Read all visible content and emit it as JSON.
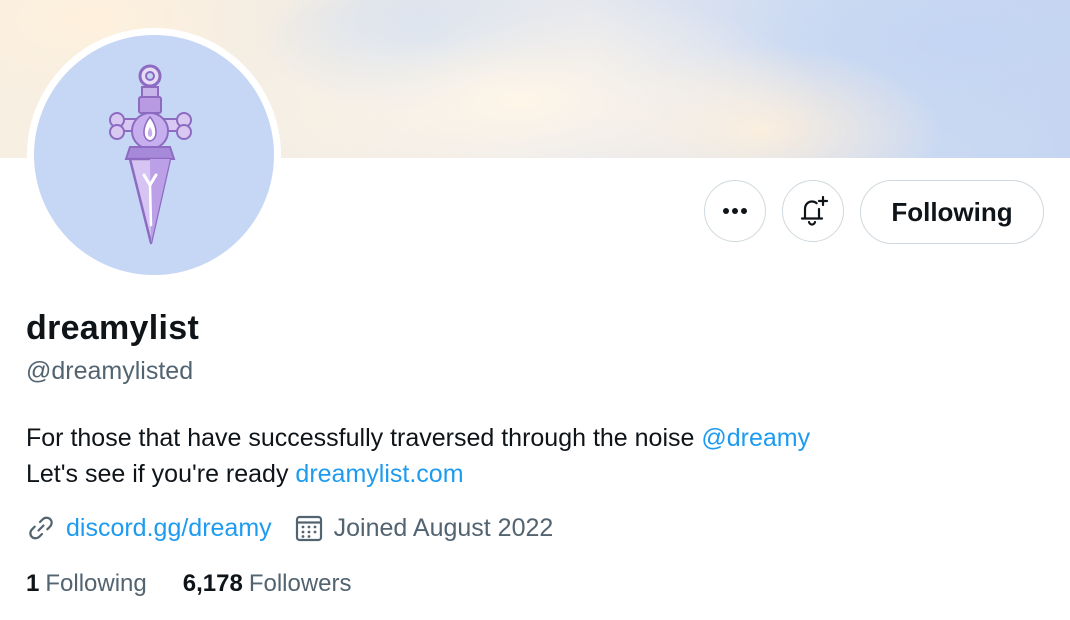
{
  "profile": {
    "display_name": "dreamylist",
    "handle": "@dreamylisted",
    "bio": {
      "line1_text": "For those that have successfully traversed through the noise ",
      "line1_mention": "@dreamy",
      "line2_text": "Let's see if you're ready ",
      "line2_link": "dreamylist.com"
    },
    "website": "discord.gg/dreamy",
    "joined": "Joined August 2022",
    "following_count": "1",
    "following_label": "Following",
    "followers_count": "6,178",
    "followers_label": "Followers"
  },
  "actions": {
    "more_label": "•••",
    "following_button_label": "Following"
  },
  "icons": {
    "more": "more-icon",
    "notify": "bell-plus-icon",
    "link": "link-icon",
    "calendar": "calendar-icon",
    "avatar_art": "sword-icon"
  },
  "colors": {
    "link": "#1d9bf0",
    "secondary_text": "#536471",
    "primary_text": "#0f1419",
    "avatar_bg": "#c6d6f5",
    "border": "#cfd9de"
  }
}
